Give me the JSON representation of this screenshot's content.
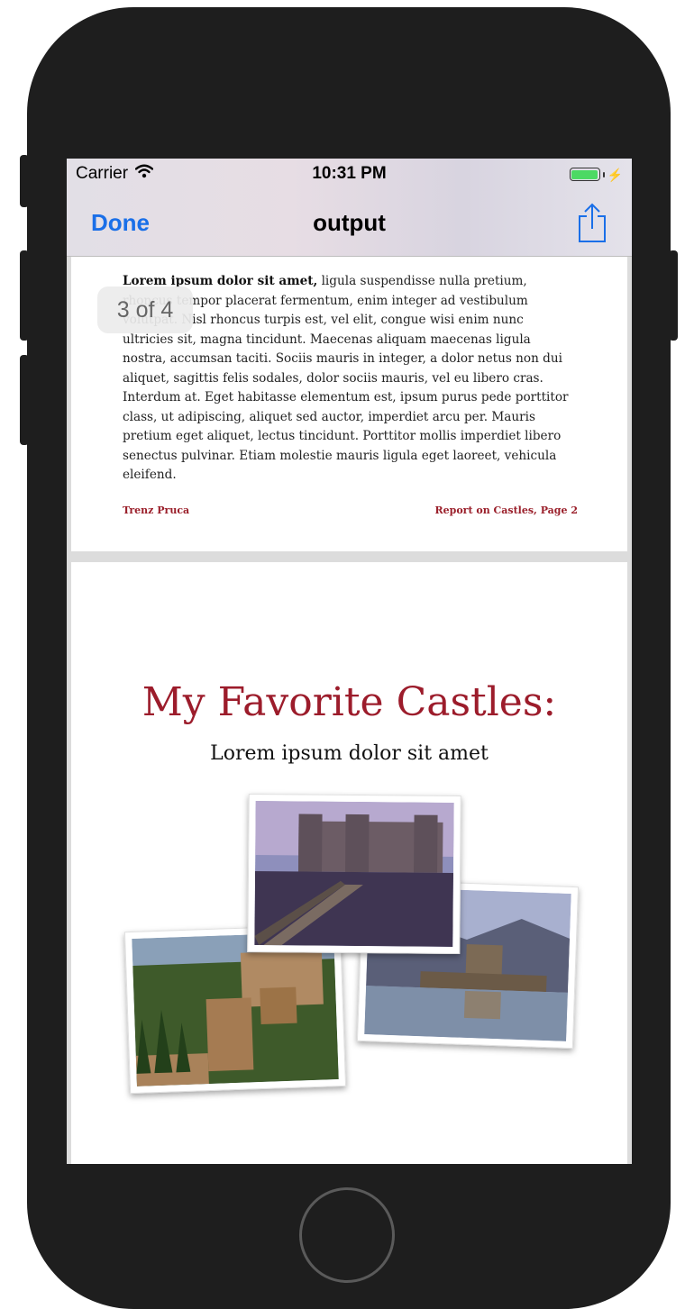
{
  "status_bar": {
    "carrier": "Carrier",
    "time": "10:31 PM"
  },
  "nav": {
    "done_label": "Done",
    "title": "output"
  },
  "page_indicator": "3 of 4",
  "page1": {
    "bold_lead": "Lorem ipsum dolor sit amet,",
    "text": " ligula suspendisse nulla pretium, rhoncus tempor placerat fermentum, enim integer ad vestibulum volutpat. Nisl rhoncus turpis est, vel elit, congue wisi enim nunc ultricies sit, magna tincidunt. Maecenas aliquam maecenas ligula nostra, accumsan taciti. Sociis mauris in integer, a dolor netus non dui aliquet, sagittis felis sodales, dolor sociis mauris, vel eu libero cras. Interdum at. Eget habitasse elementum est, ipsum purus pede porttitor class, ut adipiscing, aliquet sed auctor, imperdiet arcu per. Mauris pretium eget aliquet, lectus tincidunt. Porttitor mollis imperdiet libero senectus pulvinar. Etiam molestie mauris ligula eget laoreet, vehicula eleifend.",
    "footer_left": "Trenz Pruca",
    "footer_right": "Report on Castles, Page 2"
  },
  "page2": {
    "title": "My Favorite Castles:",
    "subtitle": "Lorem ipsum dolor sit amet"
  },
  "colors": {
    "accent_blue": "#1a6fe8",
    "title_red": "#9c1c2b",
    "battery_green": "#4cd964"
  }
}
